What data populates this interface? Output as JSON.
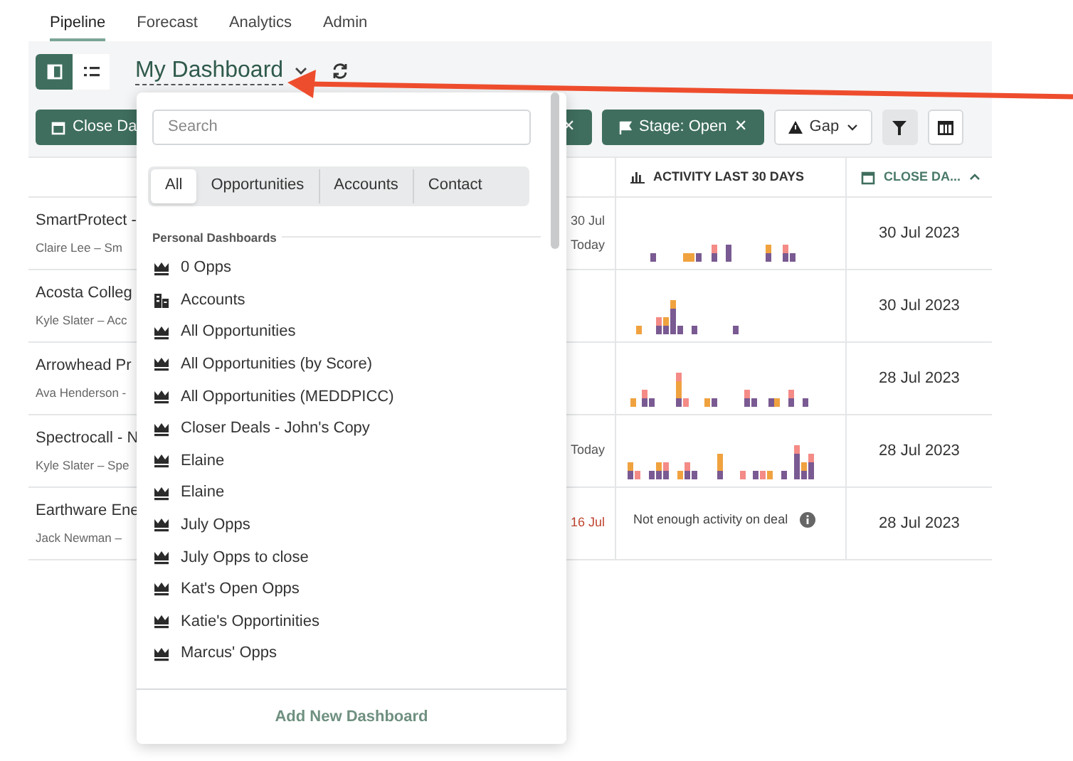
{
  "nav_tabs": [
    {
      "label": "Pipeline",
      "selected": true
    },
    {
      "label": "Forecast",
      "selected": false
    },
    {
      "label": "Analytics",
      "selected": false
    },
    {
      "label": "Admin",
      "selected": false
    }
  ],
  "view_toggle": [
    {
      "kind": "board",
      "selected": true
    },
    {
      "kind": "list",
      "selected": false
    }
  ],
  "dashboard_title": "My Dashboard",
  "filters": [
    {
      "kind": "date",
      "label": "Close Da"
    },
    {
      "kind": "hidden",
      "remove": "✕"
    },
    {
      "kind": "stage",
      "label": "Stage: Open",
      "remove": "✕"
    }
  ],
  "gap_button": "Gap",
  "filter_button": {
    "active": true
  },
  "table": {
    "columns": [
      {
        "kind": "activity",
        "label": "ACTIVITY LAST 30 DAYS",
        "sorted": false
      },
      {
        "kind": "date",
        "label": "CLOSE DA...",
        "sorted": true
      }
    ],
    "rows": [
      {
        "name": "SmartProtect -",
        "owner": "Claire Lee – Sm",
        "dates": [
          {
            "text": "30 Jul",
            "overdue": false
          },
          {
            "text": "Today",
            "overdue": false
          }
        ],
        "activity": {
          "kind": "chart"
        },
        "close_date": "30 Jul 2023"
      },
      {
        "name": "Acosta Colleg",
        "owner": "Kyle Slater – Acc",
        "activity": {
          "kind": "chart"
        },
        "close_date": "30 Jul 2023"
      },
      {
        "name": "Arrowhead Pr",
        "owner": "Ava Henderson -",
        "activity": {
          "kind": "chart"
        },
        "close_date": "28 Jul 2023"
      },
      {
        "name": "Spectrocall - N",
        "owner": "Kyle Slater – Spe",
        "dates": [
          {
            "text": "Today",
            "overdue": false
          }
        ],
        "activity": {
          "kind": "chart"
        },
        "close_date": "28 Jul 2023"
      },
      {
        "name": "Earthware Ene",
        "owner": "Jack Newman –",
        "dates": [
          {
            "text": "16 Jul",
            "overdue": true
          }
        ],
        "activity": {
          "kind": "empty",
          "text": "Not enough activity on deal"
        },
        "close_date": "28 Jul 2023"
      }
    ]
  },
  "dropdown": {
    "search": {
      "placeholder": "Search"
    },
    "segments": [
      {
        "label": "All",
        "selected": true
      },
      {
        "label": "Opportunities",
        "selected": false
      },
      {
        "label": "Accounts",
        "selected": false
      },
      {
        "label": "Contact",
        "selected": false
      }
    ],
    "section": "Personal Dashboards",
    "items": [
      {
        "kind": "opportunity",
        "label": "0 Opps"
      },
      {
        "kind": "account",
        "label": "Accounts"
      },
      {
        "kind": "opportunity",
        "label": "All Opportunities"
      },
      {
        "kind": "opportunity",
        "label": "All Opportunities (by Score)"
      },
      {
        "kind": "opportunity",
        "label": "All Opportunities (MEDDPICC)"
      },
      {
        "kind": "opportunity",
        "label": "Closer Deals - John's Copy"
      },
      {
        "kind": "opportunity",
        "label": "Elaine"
      },
      {
        "kind": "opportunity",
        "label": "Elaine"
      },
      {
        "kind": "opportunity",
        "label": "July Opps"
      },
      {
        "kind": "opportunity",
        "label": "July Opps to close"
      },
      {
        "kind": "opportunity",
        "label": "Kat's Open Opps"
      },
      {
        "kind": "opportunity",
        "label": "Katie's Opportinities"
      },
      {
        "kind": "opportunity",
        "label": "Marcus' Opps"
      }
    ],
    "footer": "Add New Dashboard"
  }
}
